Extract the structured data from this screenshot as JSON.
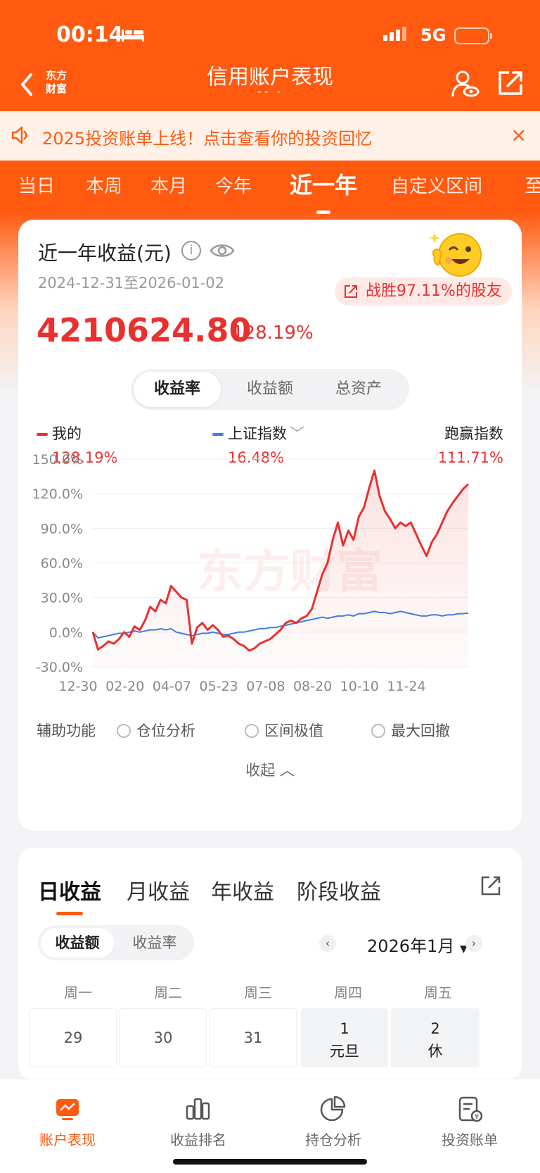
{
  "status_bar": {
    "time": "00:14",
    "network": "5G"
  },
  "nav": {
    "logo_line1": "东方",
    "logo_line2": "财富",
    "title": "信用账户表现",
    "subtitle": "⁃⁃ ⁃"
  },
  "notice": {
    "text": "2025投资账单上线！点击查看你的投资回忆",
    "close": "×"
  },
  "period_tabs": [
    {
      "label": "当日"
    },
    {
      "label": "本周"
    },
    {
      "label": "本月"
    },
    {
      "label": "今年"
    },
    {
      "label": "近一年"
    },
    {
      "label": "自定义区间"
    },
    {
      "label": "至"
    }
  ],
  "summary": {
    "title": "近一年收益(元)",
    "info": "i",
    "date_range": "2024-12-31至2026-01-02",
    "beat_text": "战胜97.11%的股友",
    "total_value": "4210624.80",
    "total_pct": "128.19%"
  },
  "chart_tabs": [
    {
      "label": "收益率"
    },
    {
      "label": "收益额"
    },
    {
      "label": "总资产"
    }
  ],
  "legend": {
    "mine": {
      "name": "我的",
      "value": "128.19%"
    },
    "index": {
      "name": "上证指数",
      "value": "16.48%"
    },
    "beat": {
      "name": "跑赢指数",
      "value": "111.71%"
    }
  },
  "colors": {
    "accent": "#ff5a10",
    "mine": "#e8312f",
    "index": "#3d7fe0"
  },
  "chart_data": {
    "type": "line",
    "xlabel": "",
    "ylabel": "",
    "ylim": [
      -30,
      150
    ],
    "y_ticks": [
      "150.0%",
      "120.0%",
      "90.0%",
      "60.0%",
      "30.0%",
      "0.0%",
      "-30.0%"
    ],
    "x_ticks": [
      "12-30",
      "02-20",
      "04-07",
      "05-23",
      "07-08",
      "08-20",
      "10-10",
      "11-24"
    ],
    "watermark": "东方财富",
    "grid": true,
    "series": [
      {
        "name": "我的",
        "values": [
          0,
          -15,
          -12,
          -8,
          -10,
          -6,
          0,
          -4,
          5,
          2,
          10,
          22,
          18,
          28,
          25,
          40,
          35,
          30,
          28,
          -10,
          4,
          8,
          2,
          6,
          2,
          -4,
          -3,
          -6,
          -10,
          -12,
          -16,
          -14,
          -10,
          -8,
          -6,
          -2,
          2,
          8,
          10,
          8,
          12,
          14,
          20,
          35,
          50,
          60,
          80,
          95,
          75,
          88,
          80,
          100,
          108,
          125,
          140,
          118,
          105,
          98,
          90,
          95,
          92,
          95,
          85,
          75,
          66,
          78,
          85,
          95,
          105,
          112,
          118,
          124,
          128.19
        ]
      },
      {
        "name": "上证指数",
        "values": [
          0,
          -5,
          -4,
          -3,
          -2,
          -1,
          -1,
          0,
          1,
          0,
          1,
          2,
          2,
          3,
          2,
          3,
          0,
          -1,
          -2,
          -3,
          -2,
          -1,
          -1,
          0,
          -1,
          -2,
          -2,
          -1,
          0,
          0,
          1,
          2,
          3,
          3,
          4,
          4,
          5,
          6,
          7,
          8,
          9,
          10,
          11,
          12,
          13,
          12,
          13,
          14,
          14,
          15,
          14,
          16,
          16,
          17,
          18,
          17,
          17,
          16,
          17,
          18,
          17,
          16,
          15,
          14,
          14,
          15,
          15,
          14,
          15,
          15,
          16,
          16,
          16.48
        ]
      }
    ]
  },
  "aux": {
    "label": "辅助功能",
    "options": [
      {
        "label": "仓位分析"
      },
      {
        "label": "区间极值"
      },
      {
        "label": "最大回撤"
      }
    ],
    "collapse": "收起"
  },
  "earnings": {
    "tabs": [
      {
        "label": "日收益"
      },
      {
        "label": "月收益"
      },
      {
        "label": "年收益"
      },
      {
        "label": "阶段收益"
      }
    ],
    "toggle": [
      {
        "label": "收益额"
      },
      {
        "label": "收益率"
      }
    ],
    "month": "2026年1月",
    "weekdays": [
      "周一",
      "周二",
      "周三",
      "周四",
      "周五"
    ],
    "days": [
      {
        "num": "29",
        "sub": ""
      },
      {
        "num": "30",
        "sub": ""
      },
      {
        "num": "31",
        "sub": ""
      },
      {
        "num": "1",
        "sub": "元旦"
      },
      {
        "num": "2",
        "sub": "休"
      }
    ]
  },
  "bottom_nav": [
    {
      "label": "账户表现"
    },
    {
      "label": "收益排名"
    },
    {
      "label": "持仓分析"
    },
    {
      "label": "投资账单"
    }
  ]
}
